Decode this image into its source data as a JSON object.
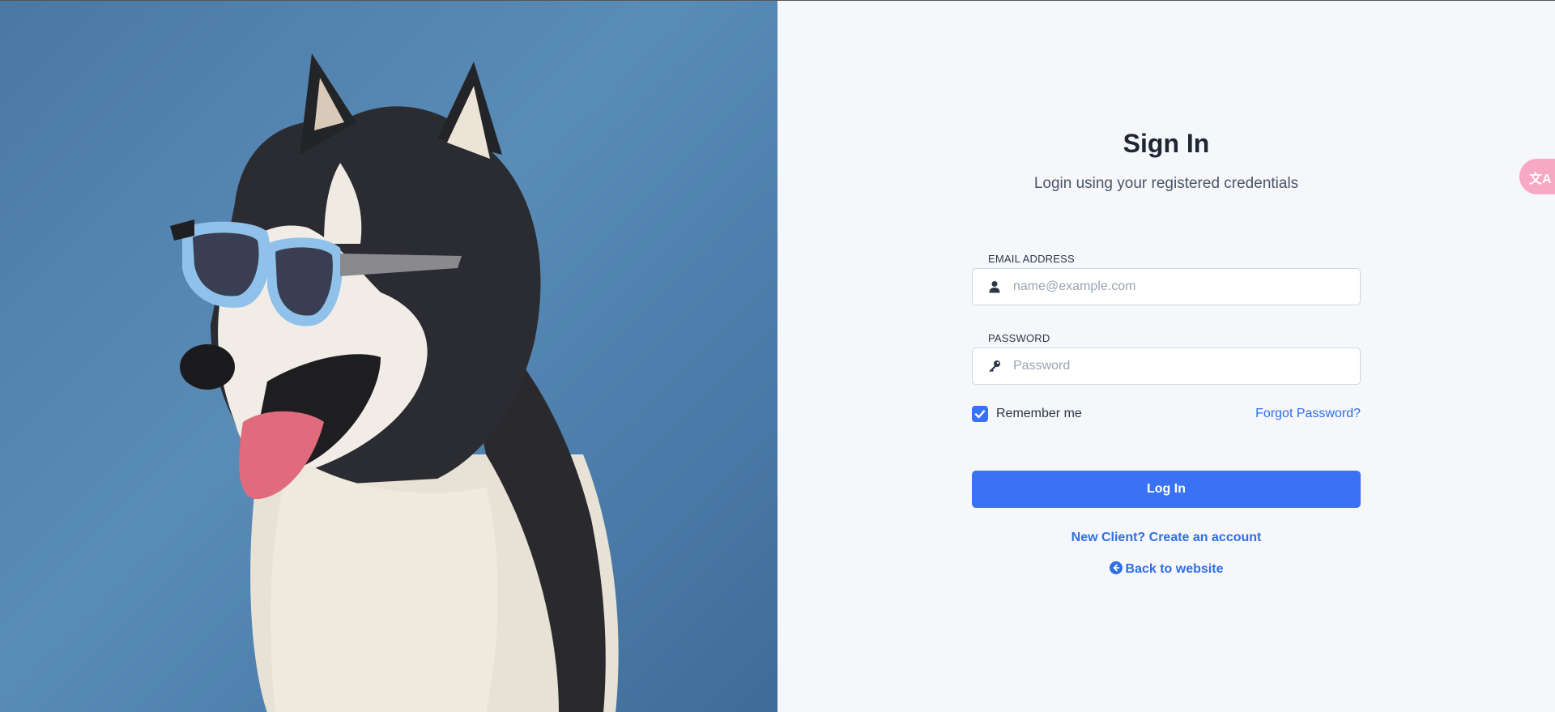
{
  "hero": {
    "image": "husky-with-sunglasses"
  },
  "login": {
    "title": "Sign In",
    "subtitle": "Login using your registered credentials",
    "email": {
      "label": "EMAIL ADDRESS",
      "placeholder": "name@example.com",
      "value": ""
    },
    "password": {
      "label": "PASSWORD",
      "placeholder": "Password",
      "value": ""
    },
    "remember_label": "Remember me",
    "remember_checked": true,
    "forgot_label": "Forgot Password?",
    "login_button": "Log In",
    "new_client_link": "New Client? Create an account",
    "back_link": "Back to website"
  },
  "translate_widget": {
    "icon": "translate-icon",
    "glyph": "文A"
  },
  "colors": {
    "accent": "#3a72f5",
    "link": "#2e6fe8",
    "hero_bg": "#5a8cb8",
    "translate_bg": "#f7a8c2"
  }
}
